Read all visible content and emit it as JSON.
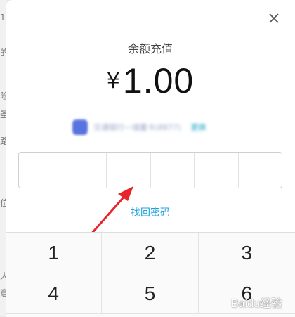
{
  "background": {
    "fragments": [
      "1",
      "的",
      "险",
      "圣",
      "路",
      "位",
      "人",
      "意"
    ]
  },
  "modal": {
    "close_icon": "close-icon",
    "title": "余额充值",
    "currency": "¥",
    "amount": "1.00",
    "payment_method": {
      "icon": "bank-card-icon",
      "text": "交通银行一储蓄卡(8877)",
      "link": "更换"
    },
    "pin_cells": 6,
    "forgot_password": "找回密码"
  },
  "keypad": {
    "keys": [
      "1",
      "2",
      "3",
      "4",
      "5",
      "6"
    ]
  },
  "watermark": "Baidu经验",
  "colors": {
    "accent": "#1ea2dd",
    "arrow": "#e8232b",
    "text": "#111111"
  }
}
